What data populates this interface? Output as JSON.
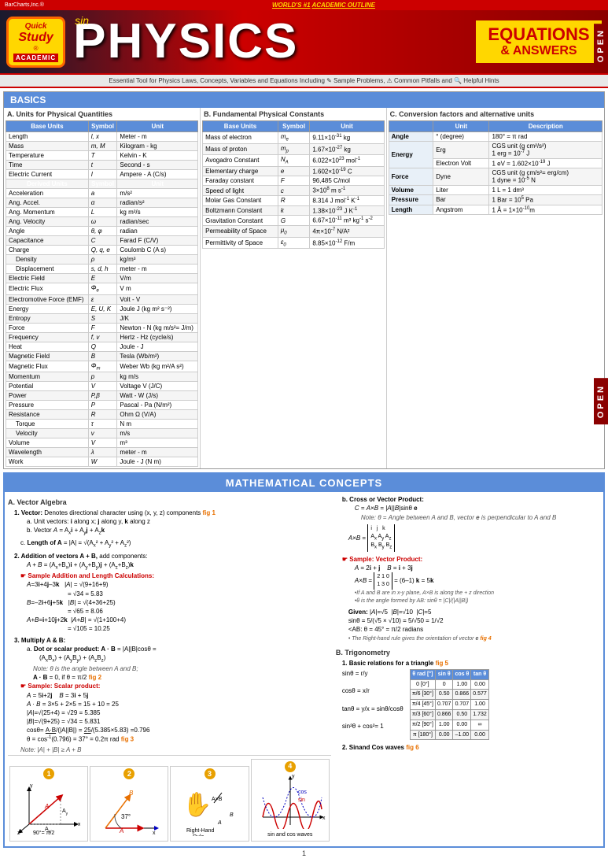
{
  "header": {
    "barcharts": "BarCharts,Inc.®",
    "world_label": "WORLD'S #1 ACADEMIC OUTLINE",
    "title": "PHYSICS",
    "subtitle": "EQUATIONS & ANSWERS",
    "sin_deco": "sin",
    "tagline": "Essential Tool for Physics Laws, Concepts, Variables and Equations Including ✎ Sample Problems, ⚠ Common Pitfalls and 🔍 Helpful Hints"
  },
  "basics": {
    "header": "BASICS",
    "col_a_title": "A. Units for Physical Quantities",
    "col_b_title": "B. Fundamental Physical Constants",
    "col_c_title": "C. Conversion factors and alternative units",
    "base_units_header": "Base Units",
    "symbol_header": "Symbol",
    "unit_header": "Unit",
    "derived_header": "Derived Units",
    "table_a_rows": [
      {
        "name": "Length",
        "symbol": "l, x",
        "unit": "Meter - m"
      },
      {
        "name": "Mass",
        "symbol": "m, M",
        "unit": "Kilogram - kg"
      },
      {
        "name": "Temperature",
        "symbol": "T",
        "unit": "Kelvin - K"
      },
      {
        "name": "Time",
        "symbol": "t",
        "unit": "Second - s"
      },
      {
        "name": "Electric Current",
        "symbol": "I",
        "unit": "Ampere - A (C/s)"
      }
    ],
    "table_a_derived_rows": [
      {
        "name": "Acceleration",
        "symbol": "a",
        "unit": "m/s²"
      },
      {
        "name": "Ang. Accel.",
        "symbol": "α",
        "unit": "radian/s²"
      },
      {
        "name": "Ang. Momentum",
        "symbol": "L",
        "unit": "kg m²/s"
      },
      {
        "name": "Ang. Velocity",
        "symbol": "ω",
        "unit": "radian/sec"
      },
      {
        "name": "Angle",
        "symbol": "θ, φ",
        "unit": "radian"
      },
      {
        "name": "Capacitance",
        "symbol": "C",
        "unit": "Farad F (C/V)"
      },
      {
        "name": "Charge",
        "symbol": "Q, q, e",
        "unit": "Coulomb C (A s)"
      },
      {
        "name": "Density",
        "symbol": "ρ",
        "unit": "kg/m³"
      },
      {
        "name": "Displacement",
        "symbol": "s, d, h",
        "unit": "meter - m"
      },
      {
        "name": "Electric Field",
        "symbol": "E",
        "unit": "V/m"
      },
      {
        "name": "Electric Flux",
        "symbol": "Φₑ",
        "unit": "V m"
      },
      {
        "name": "Electromotive Force (EMF)",
        "symbol": "ε",
        "unit": "Volt - V"
      },
      {
        "name": "Energy",
        "symbol": "E, U, K",
        "unit": "Joule J (kg m² s⁻²)"
      },
      {
        "name": "Entropy",
        "symbol": "S",
        "unit": "J/K"
      },
      {
        "name": "Force",
        "symbol": "F",
        "unit": "Newton - N (kg m/s² = J/m)"
      },
      {
        "name": "Frequency",
        "symbol": "f, v",
        "unit": "Hertz - Hz (cycle/s)"
      },
      {
        "name": "Heat",
        "symbol": "Q",
        "unit": "Joule - J"
      },
      {
        "name": "Magnetic Field",
        "symbol": "B",
        "unit": "Tesla (Wb/m²)"
      },
      {
        "name": "Magnetic Flux",
        "symbol": "Φₘ",
        "unit": "Weber Wb (kg m²/A s²)"
      },
      {
        "name": "Momentum",
        "symbol": "p",
        "unit": "kg m/s"
      },
      {
        "name": "Potential",
        "symbol": "V",
        "unit": "Voltage V (J/C)"
      },
      {
        "name": "Power",
        "symbol": "P,β",
        "unit": "Watt - W (J/s)"
      },
      {
        "name": "Pressure",
        "symbol": "P",
        "unit": "Pascal - Pa (N/m²)"
      },
      {
        "name": "Resistance",
        "symbol": "R",
        "unit": "Ohm Ω (V/A)"
      },
      {
        "name": "Torque",
        "symbol": "τ",
        "unit": "N m"
      },
      {
        "name": "Velocity",
        "symbol": "v",
        "unit": "m/s"
      },
      {
        "name": "Volume",
        "symbol": "V",
        "unit": "m³"
      },
      {
        "name": "Wavelength",
        "symbol": "λ",
        "unit": "meter - m"
      },
      {
        "name": "Work",
        "symbol": "W",
        "unit": "Joule - J (N m)"
      }
    ],
    "table_b_rows": [
      {
        "name": "Mass of electron",
        "symbol": "mₑ",
        "unit": "9.11×10⁻³¹ kg"
      },
      {
        "name": "Mass of proton",
        "symbol": "mₚ",
        "unit": "1.67×10⁻²⁷ kg"
      },
      {
        "name": "Avogadro Constant",
        "symbol": "Nₐ",
        "unit": "6.022×10²³ mol⁻¹"
      },
      {
        "name": "Elementary charge",
        "symbol": "e",
        "unit": "1.602×10⁻¹⁹ C"
      },
      {
        "name": "Faraday constant",
        "symbol": "F",
        "unit": "96,485 C/mol"
      },
      {
        "name": "Speed of light",
        "symbol": "c",
        "unit": "3×10⁸ m s⁻¹"
      },
      {
        "name": "Molar Gas Constant",
        "symbol": "R",
        "unit": "8.314 J mol⁻¹ K⁻¹"
      },
      {
        "name": "Boltzmann Constant",
        "symbol": "k",
        "unit": "1.38×10⁻²³ J K⁻¹"
      },
      {
        "name": "Gravitation Constant",
        "symbol": "G",
        "unit": "6.67×10⁻¹¹ m³ kg⁻¹ s⁻²"
      },
      {
        "name": "Permeability of Space",
        "symbol": "μ₀",
        "unit": "4π×10⁻⁷ N/A²"
      },
      {
        "name": "Permittivity of Space",
        "symbol": "ε₀",
        "unit": "8.85×10⁻¹² F/m"
      }
    ],
    "conv_groups": [
      {
        "group": "Angle",
        "unit": "° (degree)",
        "desc": "180° = π rad"
      },
      {
        "group": "Energy",
        "unit": "Erg",
        "desc": "CGS unit (g cm²/s²)\n1 erg = 10⁻⁷ J"
      },
      {
        "group": "Energy",
        "unit": "Electron Volt",
        "desc": "1 eV = 1.602×10⁻¹⁹ J"
      },
      {
        "group": "Force",
        "unit": "Dyne",
        "desc": "CGS unit (g cm/s² = erg/cm)\n1 dyne = 10⁻⁵ N"
      },
      {
        "group": "Volume",
        "unit": "Liter",
        "desc": "1 L = 1 dm³"
      },
      {
        "group": "Pressure",
        "unit": "Bar",
        "desc": "1 Bar = 10⁵ Pa"
      },
      {
        "group": "Length",
        "unit": "Angstrom",
        "desc": "1 Å = 1×10⁻¹⁰m"
      }
    ]
  },
  "math_concepts": {
    "header": "MATHEMATICAL CONCEPTS",
    "vector_algebra_title": "A. Vector Algebra",
    "trig_title": "B. Trigonometry",
    "page_number": "1"
  },
  "open_label": "OPEN"
}
